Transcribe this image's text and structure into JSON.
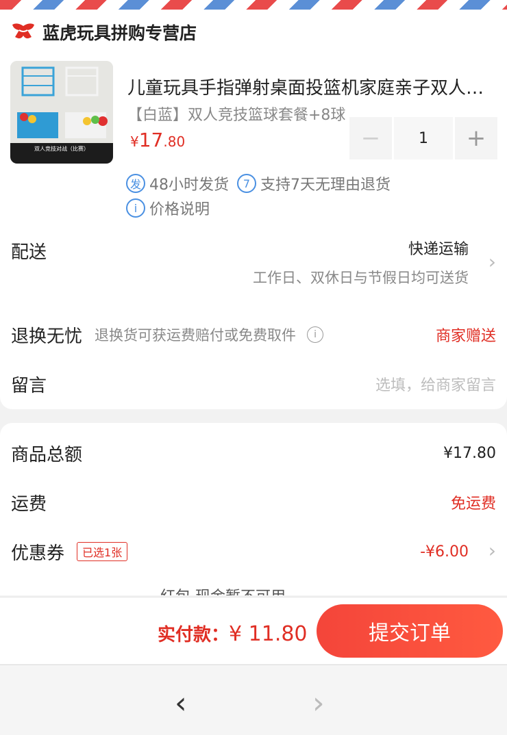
{
  "shop": {
    "name": "蓝虎玩具拼购专营店",
    "logo_icon": "pinduoduo-logo"
  },
  "product": {
    "title": "儿童玩具手指弹射桌面投篮机家庭亲子双人竞技篮球",
    "spec": "【白蓝】双人竞技篮球套餐+8球",
    "image_caption": "双人竞技对战（比赛）",
    "price_symbol": "¥",
    "price_int": "17",
    "price_dec": ".80",
    "quantity": "1",
    "minus": "−",
    "plus": "+",
    "tags": [
      {
        "icon_text": "发",
        "text": "48小时发货"
      },
      {
        "icon_text": "7",
        "text": "支持7天无理由退货"
      },
      {
        "icon_text": "i",
        "text": "价格说明"
      }
    ]
  },
  "delivery": {
    "label": "配送",
    "method": "快递运输",
    "note": "工作日、双休日与节假日均可送货"
  },
  "returns": {
    "label": "退换无忧",
    "desc": "退换货可获运费赔付或免费取件",
    "right": "商家赠送"
  },
  "message": {
    "label": "留言",
    "placeholder": "选填，给商家留言"
  },
  "summary": {
    "goods_total_label": "商品总额",
    "goods_total": "¥17.80",
    "shipping_label": "运费",
    "shipping": "免运费",
    "coupon_label": "优惠券",
    "coupon_badge": "已选1张",
    "coupon_value": "-¥6.00",
    "partial_row": "红包  现金暂不可用"
  },
  "footer": {
    "pay_label": "实付款：",
    "pay_amount": "¥ 11.80",
    "submit": "提交订单"
  },
  "colors": {
    "accent": "#e02e24",
    "info_blue": "#4a90e2"
  }
}
